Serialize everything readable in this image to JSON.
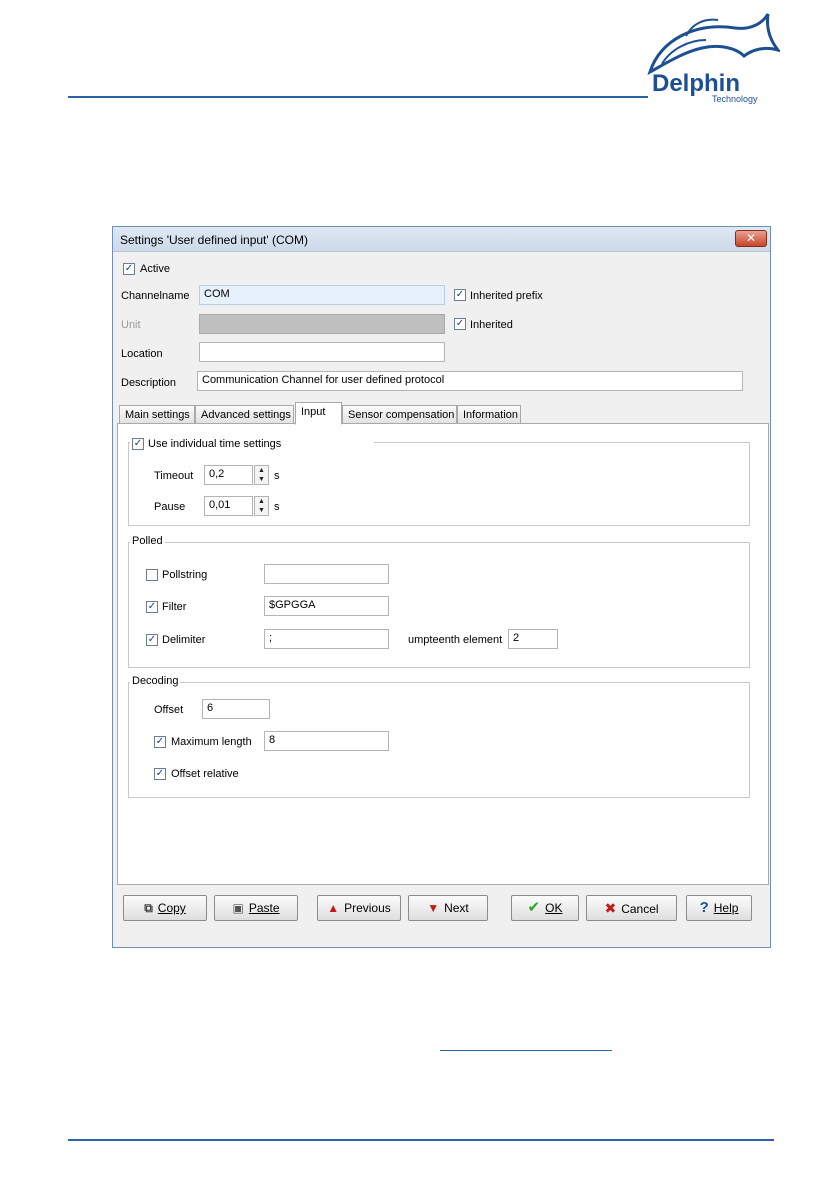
{
  "logo": {
    "brand": "Delphin",
    "sub": "Technology",
    "color": "#1d4f93"
  },
  "dialog": {
    "title": "Settings 'User defined input' (COM)",
    "active_label": "Active",
    "active_checked": true,
    "channelname_label": "Channelname",
    "channelname_value": "COM",
    "inherited_prefix_label": "Inherited prefix",
    "unit_label": "Unit",
    "unit_value": "",
    "inherited_label": "Inherited",
    "location_label": "Location",
    "location_value": "",
    "description_label": "Description",
    "description_value": "Communication Channel for user defined protocol"
  },
  "tabs": [
    {
      "label": "Main settings"
    },
    {
      "label": "Advanced settings"
    },
    {
      "label": "Input"
    },
    {
      "label": "Sensor compensation"
    },
    {
      "label": "Information"
    }
  ],
  "timing": {
    "use_individual_label": "Use individual time settings",
    "timeout_label": "Timeout",
    "timeout_value": "0,2",
    "timeout_unit": "s",
    "pause_label": "Pause",
    "pause_value": "0,01",
    "pause_unit": "s"
  },
  "polled": {
    "legend": "Polled",
    "pollstring_label": "Pollstring",
    "pollstring_value": "",
    "filter_label": "Filter",
    "filter_value": "$GPGGA",
    "delimiter_label": "Delimiter",
    "delimiter_value": ";",
    "umpteenth_label": "umpteenth element",
    "umpteenth_value": "2"
  },
  "decoding": {
    "legend": "Decoding",
    "offset_label": "Offset",
    "offset_value": "6",
    "maxlen_label": "Maximum length",
    "maxlen_value": "8",
    "offset_relative_label": "Offset relative"
  },
  "buttons": {
    "copy": "Copy",
    "paste": "Paste",
    "previous": "Previous",
    "next": "Next",
    "ok": "OK",
    "cancel": "Cancel",
    "help": "Help"
  }
}
